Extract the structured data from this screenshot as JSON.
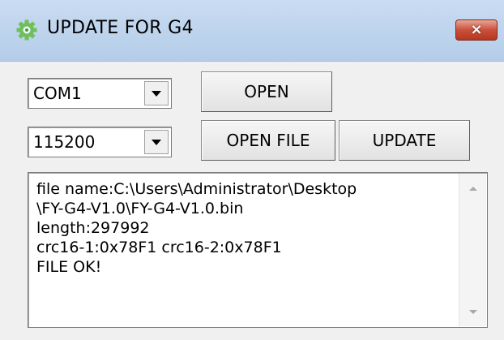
{
  "window": {
    "title": "UPDATE FOR G4",
    "close_label": "×"
  },
  "controls": {
    "port_value": "COM1",
    "baud_value": "115200",
    "open_label": "OPEN",
    "open_file_label": "OPEN FILE",
    "update_label": "UPDATE"
  },
  "log": {
    "lines": [
      "file name:C:\\Users\\Administrator\\Desktop",
      "\\FY-G4-V1.0\\FY-G4-V1.0.bin",
      "length:297992",
      "crc16-1:0x78F1 crc16-2:0x78F1",
      "FILE OK!"
    ]
  },
  "icons": {
    "app": "gear-icon",
    "close": "close-icon",
    "dropdown": "chevron-down-icon",
    "scroll_up": "scroll-up-arrow-icon",
    "scroll_down": "scroll-down-arrow-icon"
  },
  "colors": {
    "titlebar": "#b9d1ea",
    "close_button": "#c9503a",
    "window_bg": "#f0f0f0"
  }
}
